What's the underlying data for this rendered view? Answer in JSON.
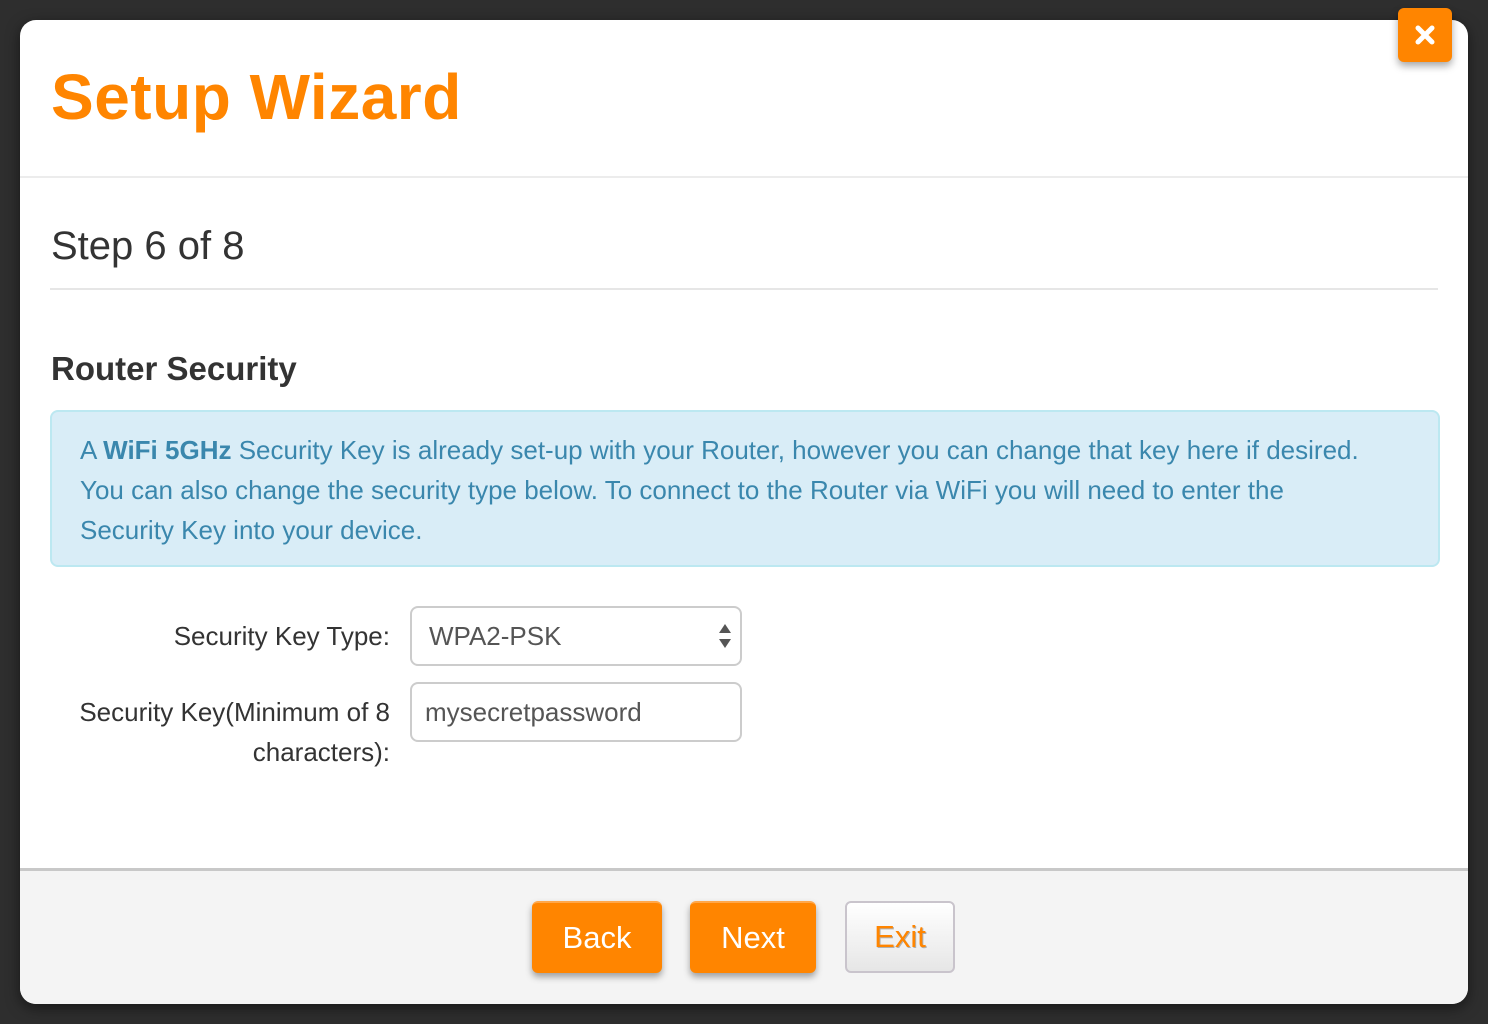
{
  "modal": {
    "title": "Setup Wizard",
    "close_icon": "close-icon"
  },
  "step": {
    "label": "Step 6 of 8",
    "current": 6,
    "total": 8
  },
  "section": {
    "title": "Router Security"
  },
  "info": {
    "prefix": "A ",
    "highlight": "WiFi 5GHz",
    "text": " Security Key is already set-up with your Router, however you can change that key here if desired. You can also change the security type below. To connect to the Router via WiFi you will need to enter the Security Key into your device."
  },
  "form": {
    "security_key_type": {
      "label": "Security Key Type:",
      "selected": "WPA2-PSK",
      "icon": "select-arrows-icon"
    },
    "security_key": {
      "label": "Security Key(Minimum of 8 characters):",
      "value": "mysecretpassword"
    }
  },
  "footer": {
    "back_label": "Back",
    "next_label": "Next",
    "exit_label": "Exit"
  },
  "colors": {
    "accent": "#ff8500",
    "info_bg": "#d9edf7",
    "info_text": "#3a87ad"
  }
}
